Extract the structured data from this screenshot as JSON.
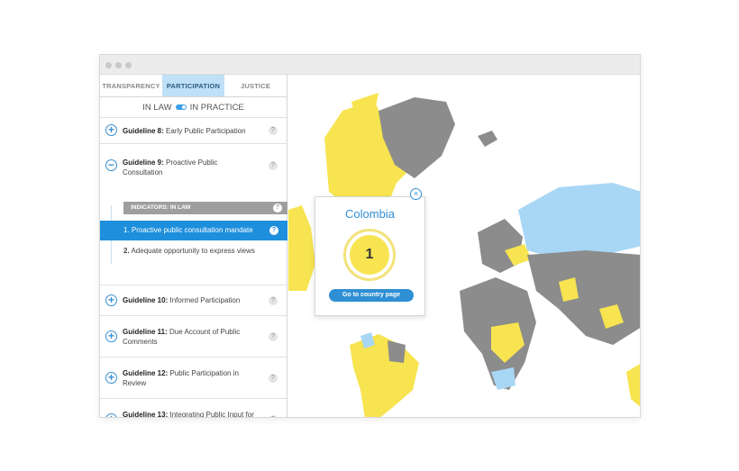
{
  "tabs": [
    "TRANSPARENCY",
    "PARTICIPATION",
    "JUSTICE"
  ],
  "toggle": {
    "left": "IN LAW",
    "right": "IN PRACTICE"
  },
  "guidelines": [
    {
      "num": "Guideline 8:",
      "text": "Early Public Participation",
      "icon": "+"
    },
    {
      "num": "Guideline 9:",
      "text": "Proactive Public Consultation",
      "icon": "−"
    },
    {
      "num": "Guideline 10:",
      "text": "Informed Participation",
      "icon": "+"
    },
    {
      "num": "Guideline 11:",
      "text": "Due Account of Public Comments",
      "icon": "+"
    },
    {
      "num": "Guideline 12:",
      "text": "Public Participation in Review",
      "icon": "+"
    },
    {
      "num": "Guideline 13:",
      "text": "Integrating Public Input for Rule-making",
      "icon": "+"
    }
  ],
  "indicators": {
    "header": "INDICATORS: IN LAW",
    "items": [
      {
        "num": "1.",
        "text": "Proactive public consultation mandate"
      },
      {
        "num": "2.",
        "text": "Adequate opportunity to express views"
      }
    ]
  },
  "help_symbol": "?",
  "popup": {
    "country": "Colombia",
    "score": "1",
    "button": "Go to country page",
    "close": "×"
  },
  "colors": {
    "accent": "#1e8fdc",
    "yellow": "#f7e450",
    "gray": "#8c8c8c",
    "lightblue": "#a8d6f5"
  }
}
